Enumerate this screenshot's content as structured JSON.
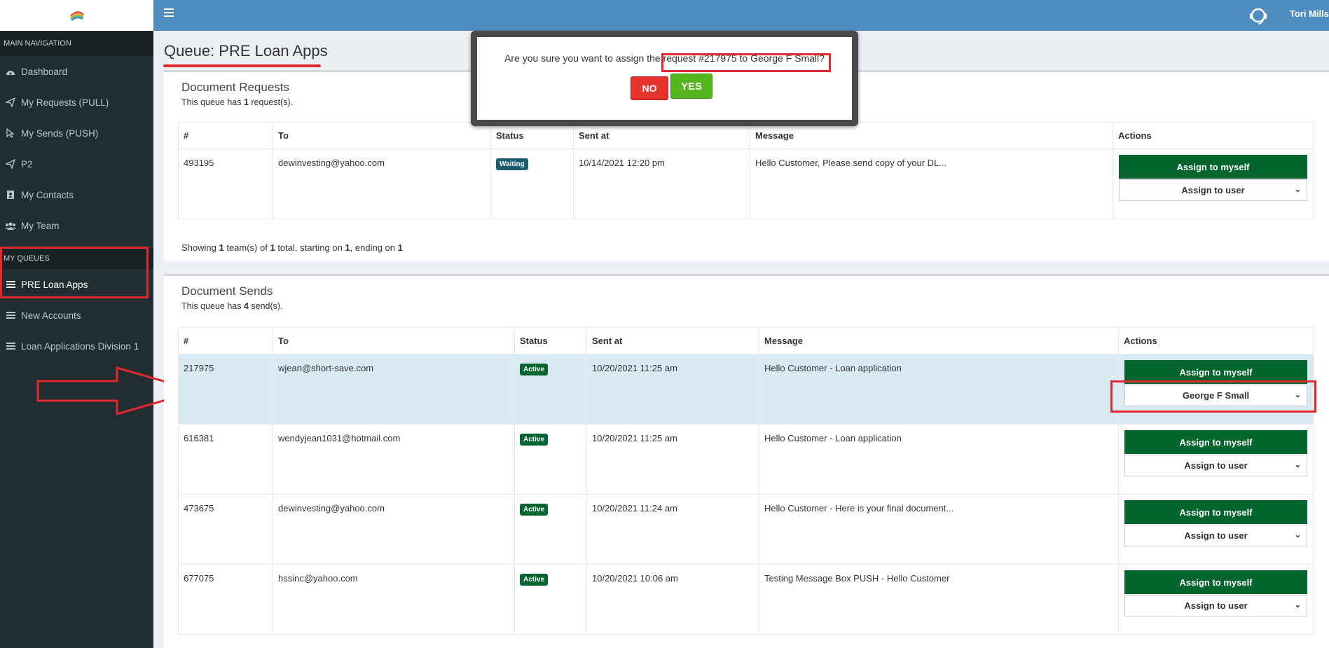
{
  "header": {
    "user_name": "Tori Mills"
  },
  "sidebar": {
    "main_nav_header": "MAIN NAVIGATION",
    "items": [
      {
        "label": "Dashboard",
        "icon": "dashboard-icon"
      },
      {
        "label": "My Requests (PULL)",
        "icon": "paper-plane-icon"
      },
      {
        "label": "My Sends (PUSH)",
        "icon": "send-cursor-icon"
      },
      {
        "label": "P2",
        "icon": "paper-plane-icon"
      },
      {
        "label": "My Contacts",
        "icon": "contact-card-icon"
      },
      {
        "label": "My Team",
        "icon": "users-icon"
      }
    ],
    "queues_header": "MY QUEUES",
    "queues": [
      {
        "label": "PRE Loan Apps",
        "icon": "list-icon"
      },
      {
        "label": "New Accounts",
        "icon": "list-icon"
      },
      {
        "label": "Loan Applications Division 1",
        "icon": "list-icon"
      }
    ]
  },
  "page": {
    "title": "Queue: PRE Loan Apps"
  },
  "requests_box": {
    "title": "Document Requests",
    "sub_prefix": "This queue has ",
    "sub_count": "1",
    "sub_suffix": " request(s).",
    "columns": [
      "#",
      "To",
      "Status",
      "Sent at",
      "Message",
      "Actions"
    ],
    "rows": [
      {
        "id": "493195",
        "to": "dewinvesting@yahoo.com",
        "status": "Waiting",
        "sent_at": "10/14/2021 12:20 pm",
        "message": "Hello Customer, Please send copy of your DL...",
        "assign_label": "Assign to myself",
        "user_select": "Assign to user"
      }
    ],
    "showing": {
      "p1": "Showing ",
      "n1": "1",
      "p2": " team(s) of ",
      "n2": "1",
      "p3": " total, starting on ",
      "n3": "1",
      "p4": ", ending on ",
      "n4": "1"
    }
  },
  "sends_box": {
    "title": "Document Sends",
    "sub_prefix": "This queue has ",
    "sub_count": "4",
    "sub_suffix": " send(s).",
    "columns": [
      "#",
      "To",
      "Status",
      "Sent at",
      "Message",
      "Actions"
    ],
    "rows": [
      {
        "id": "217975",
        "to": "wjean@short-save.com",
        "status": "Active",
        "sent_at": "10/20/2021 11:25 am",
        "message": "Hello Customer - Loan application",
        "assign_label": "Assign to myself",
        "user_select": "George F Small"
      },
      {
        "id": "616381",
        "to": "wendyjean1031@hotmail.com",
        "status": "Active",
        "sent_at": "10/20/2021 11:25 am",
        "message": "Hello Customer - Loan application",
        "assign_label": "Assign to myself",
        "user_select": "Assign to user"
      },
      {
        "id": "473675",
        "to": "dewinvesting@yahoo.com",
        "status": "Active",
        "sent_at": "10/20/2021 11:24 am",
        "message": "Hello Customer - Here is your final document...",
        "assign_label": "Assign to myself",
        "user_select": "Assign to user"
      },
      {
        "id": "677075",
        "to": "hssinc@yahoo.com",
        "status": "Active",
        "sent_at": "10/20/2021 10:06 am",
        "message": "Testing Message Box PUSH - Hello Customer",
        "assign_label": "Assign to myself",
        "user_select": "Assign to user"
      }
    ]
  },
  "modal": {
    "text": "Are you sure you want to assign the request #217975 to George F Small?",
    "no_label": "NO",
    "yes_label": "YES"
  },
  "colors": {
    "sidebar_bg": "#222d32",
    "topbar_bg": "#4f8cc0",
    "assign_button": "#05652f",
    "badge_waiting": "#1d5c6e",
    "badge_active": "#05652f",
    "annotation_red": "#e0282f",
    "no_button": "#e5322d",
    "yes_button": "#55b51c"
  }
}
